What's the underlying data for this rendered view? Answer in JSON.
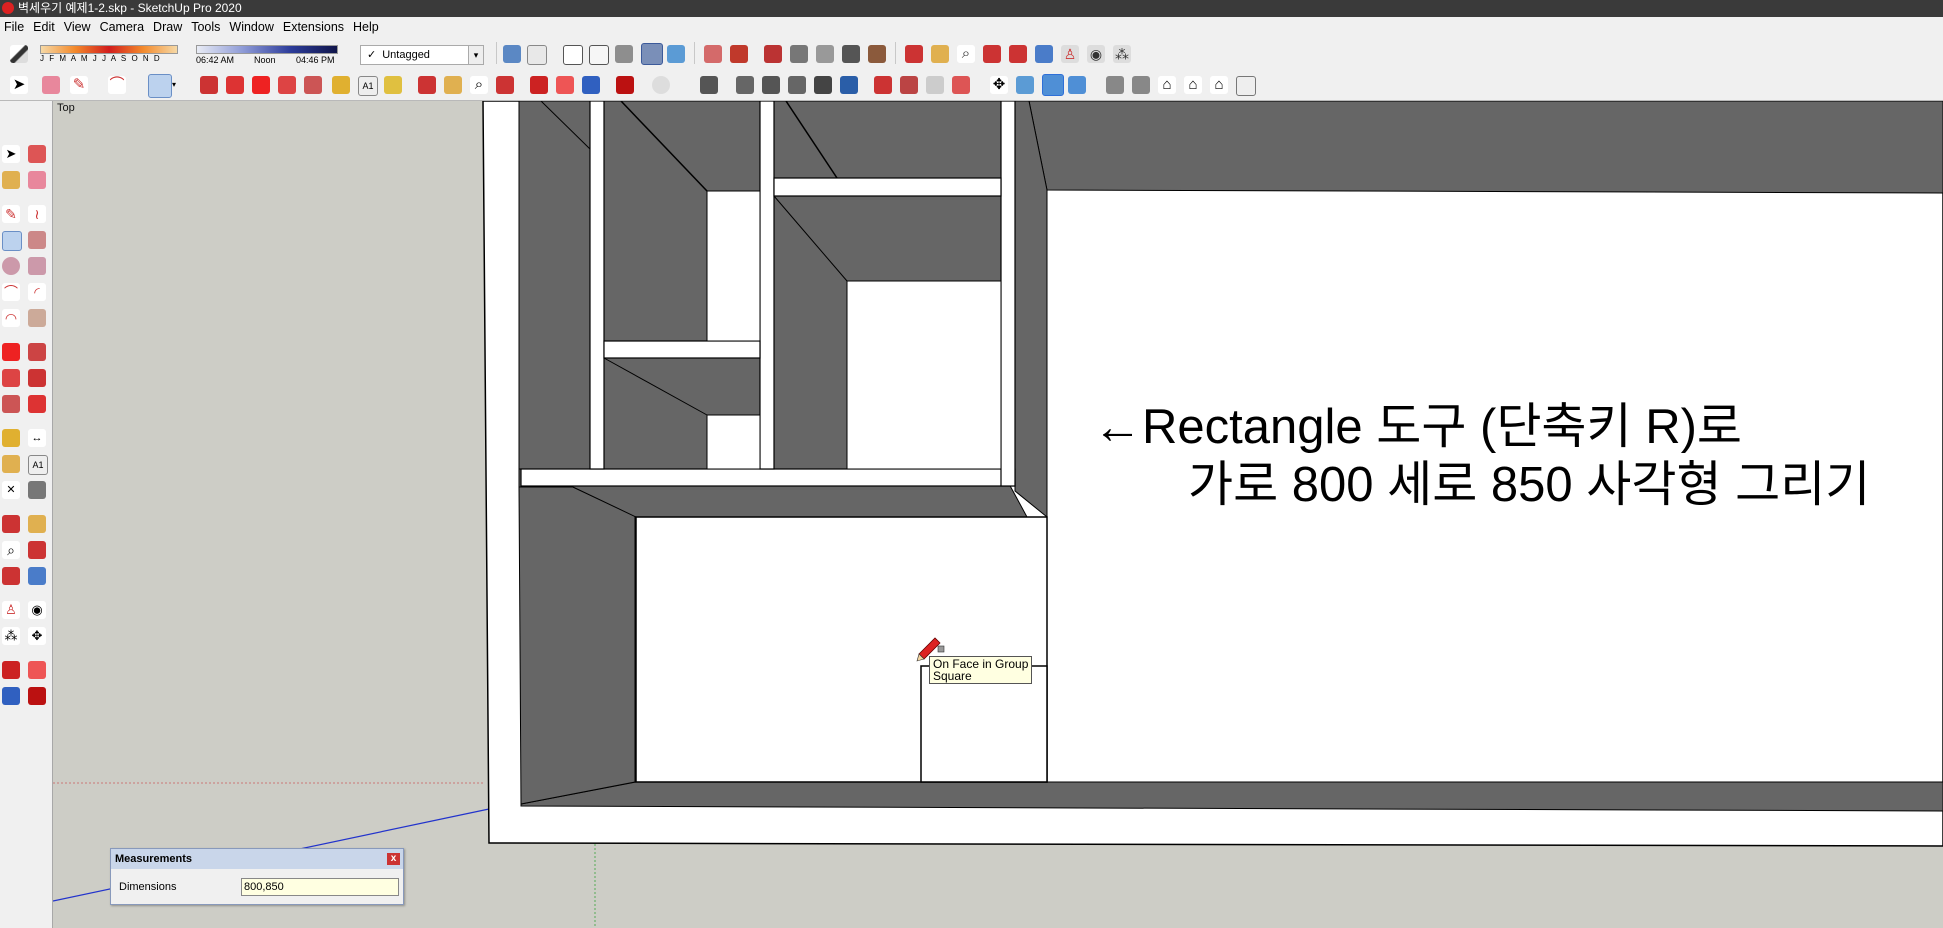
{
  "app": {
    "title": "벽세우기 예제1-2.skp - SketchUp Pro 2020"
  },
  "menu": [
    "File",
    "Edit",
    "View",
    "Camera",
    "Draw",
    "Tools",
    "Window",
    "Extensions",
    "Help"
  ],
  "shadow": {
    "months": "J F M A M J J A S O N D",
    "time_start": "06:42 AM",
    "time_mid": "Noon",
    "time_end": "04:46 PM"
  },
  "tag_selector": {
    "value": "Untagged"
  },
  "viewport": {
    "scene_label": "Top",
    "annotation_line1": "←Rectangle 도구 (단축키 R)로",
    "annotation_line2": "가로 800 세로 850 사각형 그리기",
    "tooltip_line1": "On Face in Group",
    "tooltip_line2": "Square"
  },
  "measurements": {
    "title": "Measurements",
    "label": "Dimensions",
    "value": "800,850"
  },
  "colors": {
    "wall_dark": "#666666",
    "wall_light": "#ffffff",
    "ground": "#cdcdc6",
    "accent_blue": "#2e6fd8"
  }
}
